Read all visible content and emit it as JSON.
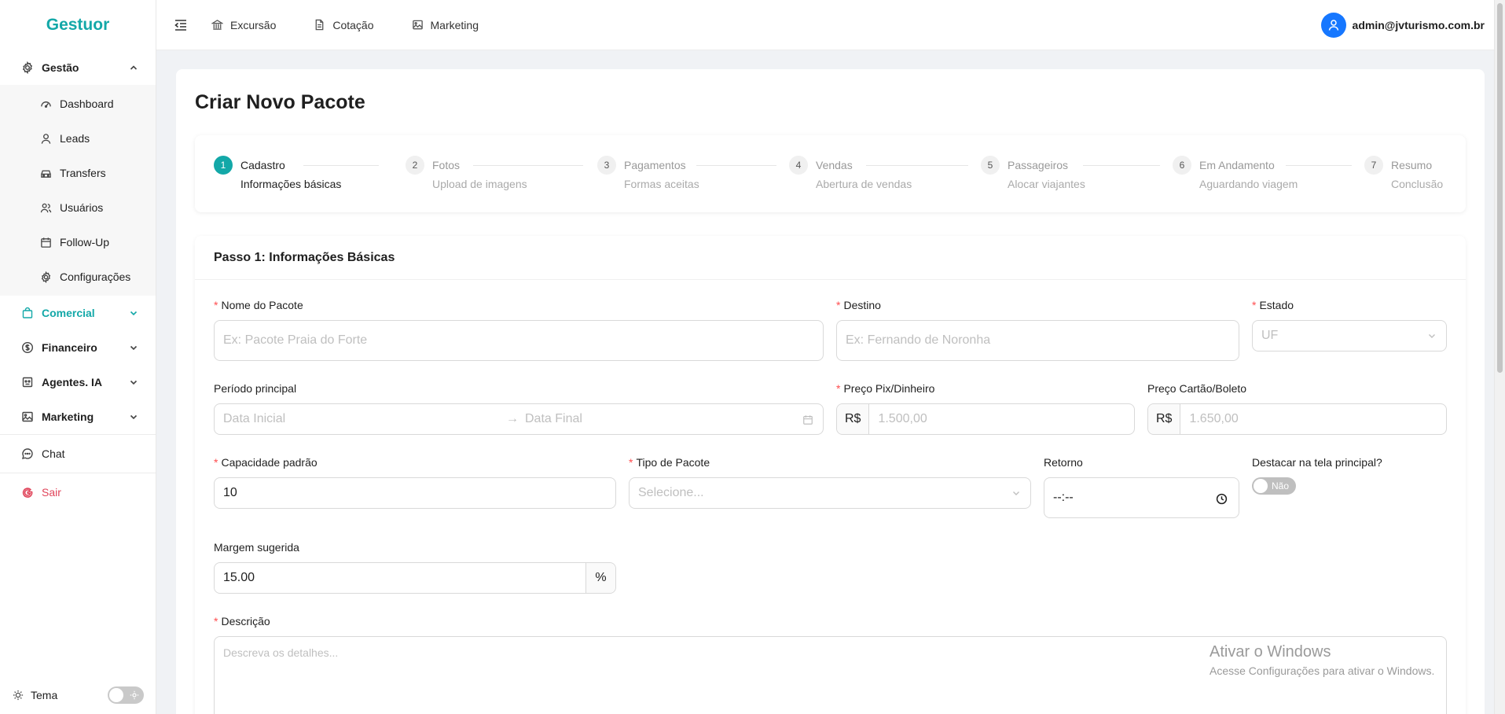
{
  "app": {
    "logo": "Gestuor"
  },
  "sidebar": {
    "groups": [
      {
        "label": "Gestão",
        "expanded": true,
        "items": [
          "Dashboard",
          "Leads",
          "Transfers",
          "Usuários",
          "Follow-Up",
          "Configurações"
        ]
      },
      {
        "label": "Comercial",
        "active": true
      },
      {
        "label": "Financeiro"
      },
      {
        "label": "Agentes. IA"
      },
      {
        "label": "Marketing"
      }
    ],
    "chat": "Chat",
    "logout": "Sair",
    "theme": "Tema"
  },
  "header": {
    "links": [
      "Excursão",
      "Cotação",
      "Marketing"
    ],
    "user_email": "admin@jvturismo.com.br"
  },
  "page": {
    "title": "Criar Novo Pacote"
  },
  "steps": [
    {
      "num": "1",
      "title": "Cadastro",
      "desc": "Informações básicas",
      "active": true
    },
    {
      "num": "2",
      "title": "Fotos",
      "desc": "Upload de imagens"
    },
    {
      "num": "3",
      "title": "Pagamentos",
      "desc": "Formas aceitas"
    },
    {
      "num": "4",
      "title": "Vendas",
      "desc": "Abertura de vendas"
    },
    {
      "num": "5",
      "title": "Passageiros",
      "desc": "Alocar viajantes"
    },
    {
      "num": "6",
      "title": "Em Andamento",
      "desc": "Aguardando viagem"
    },
    {
      "num": "7",
      "title": "Resumo",
      "desc": "Conclusão"
    }
  ],
  "form": {
    "heading": "Passo 1: Informações Básicas",
    "nome": {
      "label": "Nome do Pacote",
      "placeholder": "Ex: Pacote Praia do Forte"
    },
    "destino": {
      "label": "Destino",
      "placeholder": "Ex: Fernando de Noronha"
    },
    "estado": {
      "label": "Estado",
      "placeholder": "UF"
    },
    "periodo": {
      "label": "Período principal",
      "start_placeholder": "Data Inicial",
      "end_placeholder": "Data Final",
      "separator": "→"
    },
    "preco_pix": {
      "label": "Preço Pix/Dinheiro",
      "prefix": "R$",
      "placeholder": "1.500,00"
    },
    "preco_cartao": {
      "label": "Preço Cartão/Boleto",
      "prefix": "R$",
      "placeholder": "1.650,00"
    },
    "capacidade": {
      "label": "Capacidade padrão",
      "value": "10"
    },
    "tipo": {
      "label": "Tipo de Pacote",
      "placeholder": "Selecione..."
    },
    "retorno": {
      "label": "Retorno",
      "value": "--:--"
    },
    "destacar": {
      "label": "Destacar na tela principal?",
      "toggle_text": "Não"
    },
    "margem": {
      "label": "Margem sugerida",
      "value": "15.00",
      "suffix": "%"
    },
    "descricao": {
      "label": "Descrição",
      "placeholder": "Descreva os detalhes..."
    }
  },
  "watermark": {
    "line1": "Ativar o Windows",
    "line2": "Acesse Configurações para ativar o Windows."
  }
}
